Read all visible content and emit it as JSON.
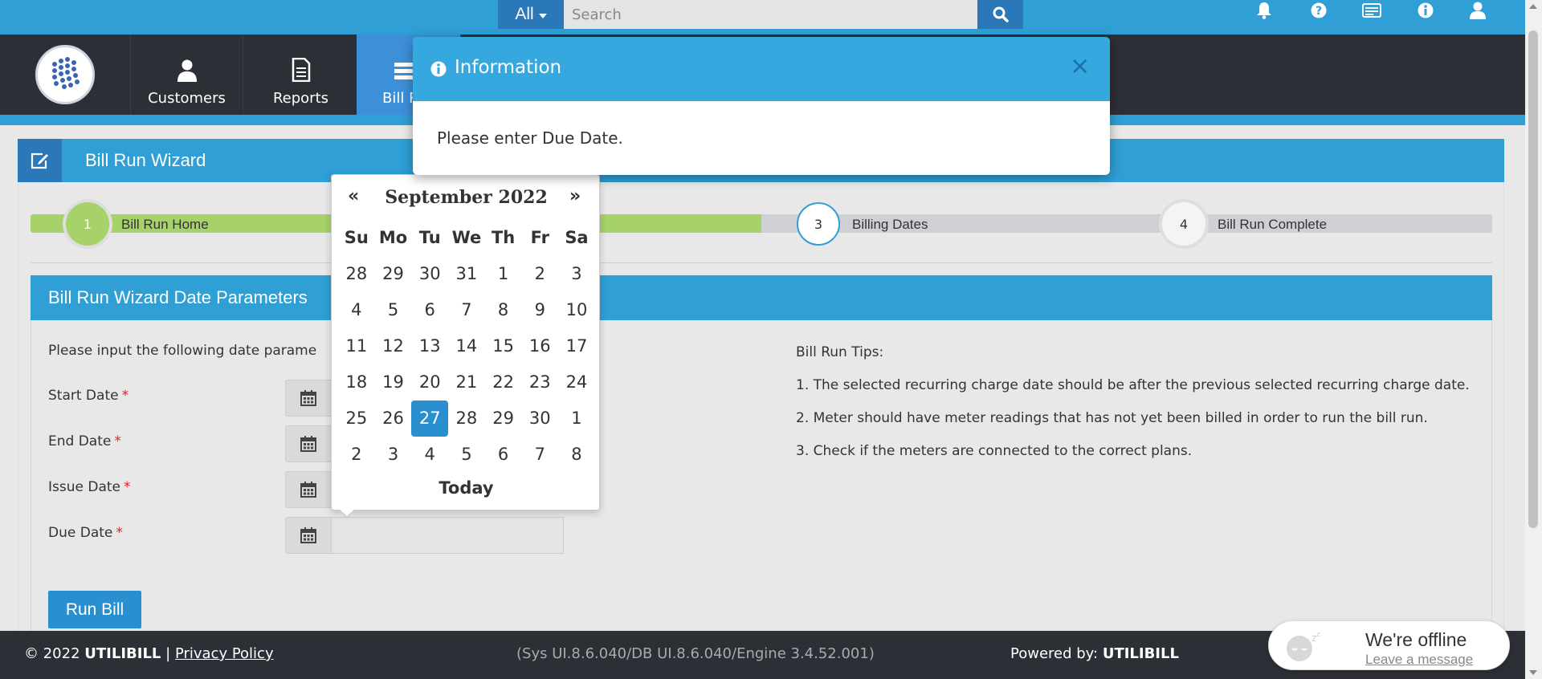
{
  "search": {
    "scope": "All",
    "placeholder": "Search"
  },
  "nav": {
    "items": [
      {
        "label": "Customers"
      },
      {
        "label": "Reports"
      },
      {
        "label": "Bill R"
      }
    ]
  },
  "wizard": {
    "title": "Bill Run Wizard",
    "steps": [
      {
        "num": "1",
        "label": "Bill Run Home"
      },
      {
        "num": "3",
        "label": "Billing Dates"
      },
      {
        "num": "4",
        "label": "Bill Run Complete"
      }
    ],
    "section_title": "Bill Run Wizard Date Parameters",
    "intro": "Please input the following date parame",
    "fields": [
      {
        "label": "Start Date"
      },
      {
        "label": "End Date"
      },
      {
        "label": "Issue Date"
      },
      {
        "label": "Due Date"
      }
    ],
    "required_mark": "*",
    "run_button": "Run Bill"
  },
  "tips": {
    "title": "Bill Run Tips:",
    "items": [
      "1. The selected recurring charge date should be after the previous selected recurring charge date.",
      "2. Meter should have meter readings that has not yet been billed in order to run the bill run.",
      "3. Check if the meters are connected to the correct plans."
    ]
  },
  "modal": {
    "title": "Information",
    "message": "Please enter Due Date.",
    "close": "×"
  },
  "datepicker": {
    "prev": "«",
    "next": "»",
    "month": "September 2022",
    "weekdays": [
      "Su",
      "Mo",
      "Tu",
      "We",
      "Th",
      "Fr",
      "Sa"
    ],
    "weeks": [
      [
        "28",
        "29",
        "30",
        "31",
        "1",
        "2",
        "3"
      ],
      [
        "4",
        "5",
        "6",
        "7",
        "8",
        "9",
        "10"
      ],
      [
        "11",
        "12",
        "13",
        "14",
        "15",
        "16",
        "17"
      ],
      [
        "18",
        "19",
        "20",
        "21",
        "22",
        "23",
        "24"
      ],
      [
        "25",
        "26",
        "27",
        "28",
        "29",
        "30",
        "1"
      ],
      [
        "2",
        "3",
        "4",
        "5",
        "6",
        "7",
        "8"
      ]
    ],
    "selected": "27",
    "today": "Today"
  },
  "footer": {
    "copyright": "© 2022",
    "brand": "UTILIBILL",
    "separator": "|",
    "privacy": "Privacy Policy",
    "version": "(Sys UI.8.6.040/DB UI.8.6.040/Engine 3.4.52.001)",
    "powered_label": "Powered by:",
    "powered_brand": "UTILIBILL"
  },
  "chat": {
    "status": "We're offline",
    "link": "Leave a message"
  },
  "colors": {
    "primary": "#2f9fd6",
    "primary_dark": "#2a78b8",
    "nav_bg": "#2d2f36",
    "progress_done": "#a7d26a",
    "required": "#d9232e"
  }
}
